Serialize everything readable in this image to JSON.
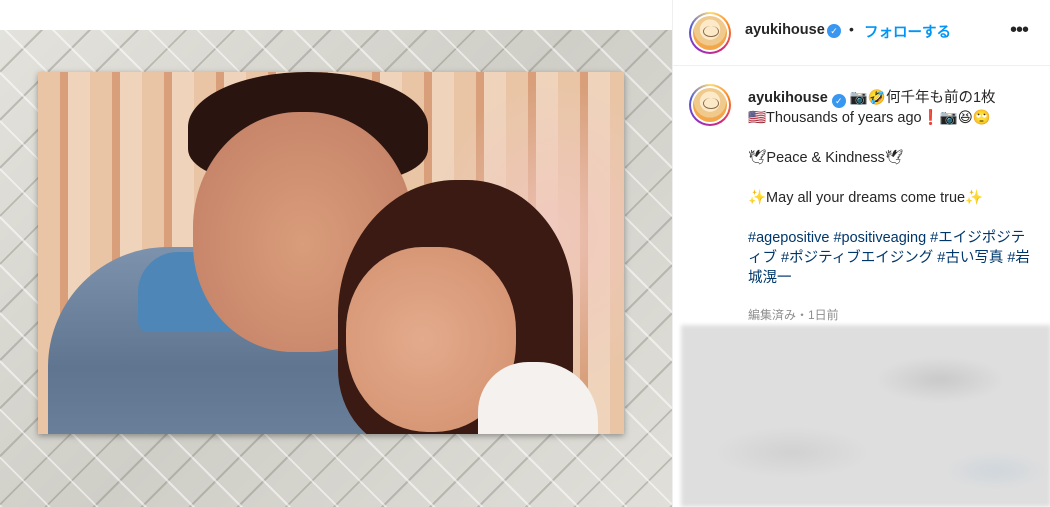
{
  "post": {
    "username": "ayukihouse",
    "verified_mark": "✓",
    "separator": "•",
    "follow_label": "フォローする",
    "more_icon": "•••"
  },
  "caption": {
    "username": "ayukihouse",
    "line1": "📷🤣何千年も前の1枚",
    "line2": "🇺🇸Thousands of years ago❗📷😆🙄",
    "line3": "🕊Peace & Kindness🕊",
    "line4": "✨May all your dreams come true✨",
    "hashtags": "#agepositive #positiveaging #エイジポジティブ #ポジティブエイジング #古い写真 #岩城滉一"
  },
  "meta": {
    "edited_time": "編集済み・1日前"
  },
  "icons": {
    "more": "more-options-icon",
    "verified": "verified-badge-icon"
  },
  "colors": {
    "accent": "#0095f6",
    "verified": "#3897f0",
    "hashtag": "#00376b",
    "meta": "#8e8e8e"
  }
}
